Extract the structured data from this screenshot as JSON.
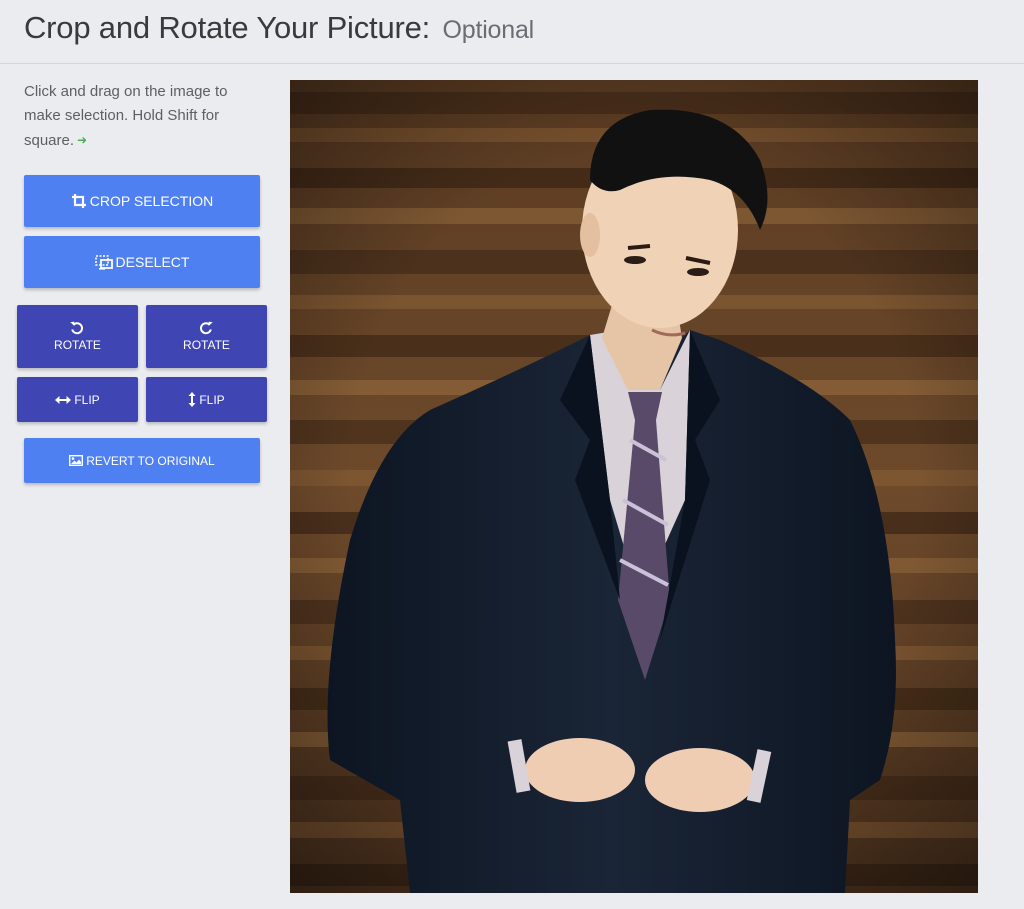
{
  "header": {
    "title": "Crop and Rotate Your Picture:",
    "subtitle": "Optional"
  },
  "instructions": {
    "text": "Click and drag on the image to make selection. Hold Shift for square.",
    "icon": "green-arrow-right-icon"
  },
  "buttons": {
    "crop": "CROP SELECTION",
    "deselect": "DESELECT",
    "rotate_left": "ROTATE",
    "rotate_right": "ROTATE",
    "flip_horizontal": "FLIP",
    "flip_vertical": "FLIP",
    "revert": "REVERT TO ORIGINAL"
  },
  "colors": {
    "primary_button": "#4f80f1",
    "secondary_button": "#3f46b4",
    "background": "#ebecf0"
  }
}
